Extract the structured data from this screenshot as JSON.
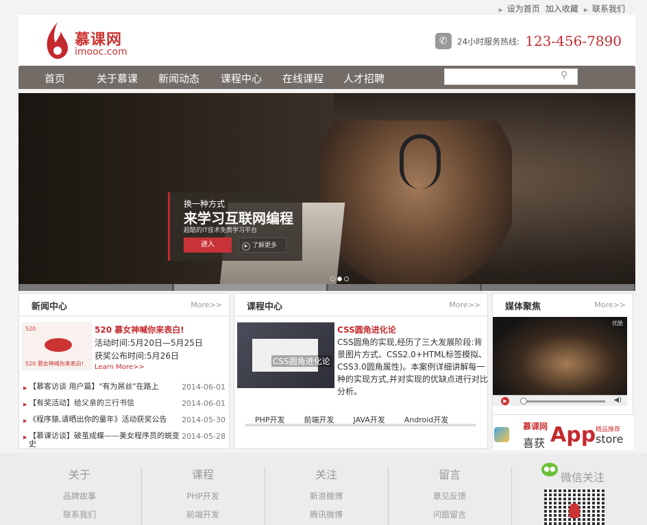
{
  "topbar": {
    "set_home": "设为首页",
    "add_fav": "加入收藏",
    "contact": "联系我们"
  },
  "logo": {
    "cn": "慕课网",
    "en": "imooc.com"
  },
  "hotline": {
    "label": "24小时服务热线:",
    "number": "123-456-7890"
  },
  "nav": {
    "items": [
      "首页",
      "关于慕课",
      "新闻动态",
      "课程中心",
      "在线课程",
      "人才招聘"
    ],
    "search_placeholder": ""
  },
  "banner": {
    "line1": "换一种方式",
    "line2": "来学习互联网编程",
    "line3": "超酷的IT技术免费学习平台",
    "enter": "进入",
    "learn_more": "了解更多"
  },
  "news": {
    "title": "新闻中心",
    "more": "More>>",
    "img_text": "520 慕女神喊你来表白!",
    "img_num": "520",
    "feat_title": "520 慕女神喊你来表白!",
    "feat_line1": "活动时间:5月20日—5月25日",
    "feat_line2": "获奖公布时间:5月26日",
    "learn": "Learn More>>",
    "list": [
      {
        "text": "【慕客访谈 用户篇】\"有为屌丝\"在路上",
        "date": "2014-06-01"
      },
      {
        "text": "【有奖活动】给父亲的三行书信",
        "date": "2014-06-01"
      },
      {
        "text": "《程序猿,请晒出你的童年》活动获奖公告",
        "date": "2014-05-30"
      },
      {
        "text": "【慕课访谈】破茧成蝶——美女程序员的蜕变史",
        "date": "2014-05-28"
      }
    ]
  },
  "course": {
    "title": "课程中心",
    "more": "More>>",
    "img_label": "CSS圆角进化论",
    "feat_title": "CSS圆角进化论",
    "desc": "CSS圆角的实现,经历了三大发展阶段:背景图片方式、CSS2.0+HTML标签模拟、CSS3.0圆角属性)。本案例详细讲解每一种的实现方式,并对实现的优缺点进行对比分析。",
    "tabs": [
      "PHP开发",
      "前端开发",
      "JAVA开发",
      "Android开发"
    ]
  },
  "media": {
    "title": "媒体聚焦",
    "more": "More>>",
    "img_label": "优酷",
    "app_brand": "慕课网",
    "app_win": "喜获",
    "app_word": "App",
    "app_tag": "精品推荐",
    "app_store": "store"
  },
  "footer": {
    "cols": [
      {
        "heading": "关于",
        "links": [
          "品牌故事",
          "联系我们"
        ]
      },
      {
        "heading": "课程",
        "links": [
          "PHP开发",
          "前端开发"
        ]
      },
      {
        "heading": "关注",
        "links": [
          "新浪微博",
          "腾讯微博"
        ]
      },
      {
        "heading": "留言",
        "links": [
          "意见反馈",
          "问题留言"
        ]
      }
    ],
    "wechat": "微信关注"
  },
  "colors": {
    "brand": "#c3292e",
    "nav": "#726b66"
  }
}
